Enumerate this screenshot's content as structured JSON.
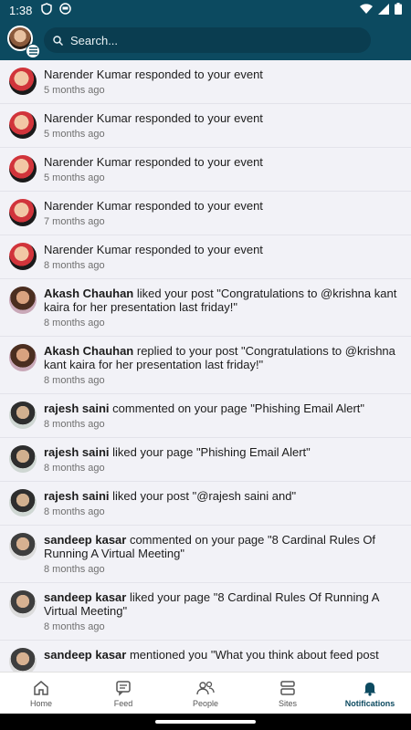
{
  "status_bar": {
    "time": "1:38"
  },
  "header": {
    "search_placeholder": "Search..."
  },
  "notifications": [
    {
      "name": "",
      "text": "Narender Kumar responded to your event",
      "time": "5 months ago",
      "avatar": "narender"
    },
    {
      "name": "",
      "text": "Narender Kumar responded to your event",
      "time": "5 months ago",
      "avatar": "narender"
    },
    {
      "name": "",
      "text": "Narender Kumar responded to your event",
      "time": "5 months ago",
      "avatar": "narender"
    },
    {
      "name": "",
      "text": "Narender Kumar responded to your event",
      "time": "7 months ago",
      "avatar": "narender"
    },
    {
      "name": "",
      "text": "Narender Kumar responded to your event",
      "time": "8 months ago",
      "avatar": "narender"
    },
    {
      "name": "Akash Chauhan",
      "text": " liked your post \"Congratulations to @krishna kant kaira for her presentation last friday!\"",
      "time": "8 months ago",
      "avatar": "akash"
    },
    {
      "name": "Akash Chauhan",
      "text": " replied to your post \"Congratulations to @krishna kant kaira for her presentation last friday!\"",
      "time": "8 months ago",
      "avatar": "akash"
    },
    {
      "name": "rajesh saini",
      "text": " commented on your page \"Phishing Email Alert\"",
      "time": "8 months ago",
      "avatar": "rajesh"
    },
    {
      "name": "rajesh saini",
      "text": " liked your page \"Phishing Email Alert\"",
      "time": "8 months ago",
      "avatar": "rajesh"
    },
    {
      "name": "rajesh saini",
      "text": " liked your post \"@rajesh saini and\"",
      "time": "8 months ago",
      "avatar": "rajesh"
    },
    {
      "name": "sandeep kasar",
      "text": " commented on your page \"8 Cardinal Rules Of Running A Virtual Meeting\"",
      "time": "8 months ago",
      "avatar": "sandeep"
    },
    {
      "name": "sandeep kasar",
      "text": " liked your page \"8 Cardinal Rules Of Running A Virtual Meeting\"",
      "time": "8 months ago",
      "avatar": "sandeep"
    },
    {
      "name": "sandeep kasar",
      "text": " mentioned you \"What you think about feed post",
      "time": "",
      "avatar": "sandeep"
    }
  ],
  "bottom_nav": [
    {
      "label": "Home",
      "icon": "home-icon"
    },
    {
      "label": "Feed",
      "icon": "feed-icon"
    },
    {
      "label": "People",
      "icon": "people-icon"
    },
    {
      "label": "Sites",
      "icon": "sites-icon"
    },
    {
      "label": "Notifications",
      "icon": "bell-icon",
      "active": true
    }
  ],
  "colors": {
    "header": "#0c4a60",
    "accent": "#0c4a60",
    "background": "#f2f2f7"
  }
}
